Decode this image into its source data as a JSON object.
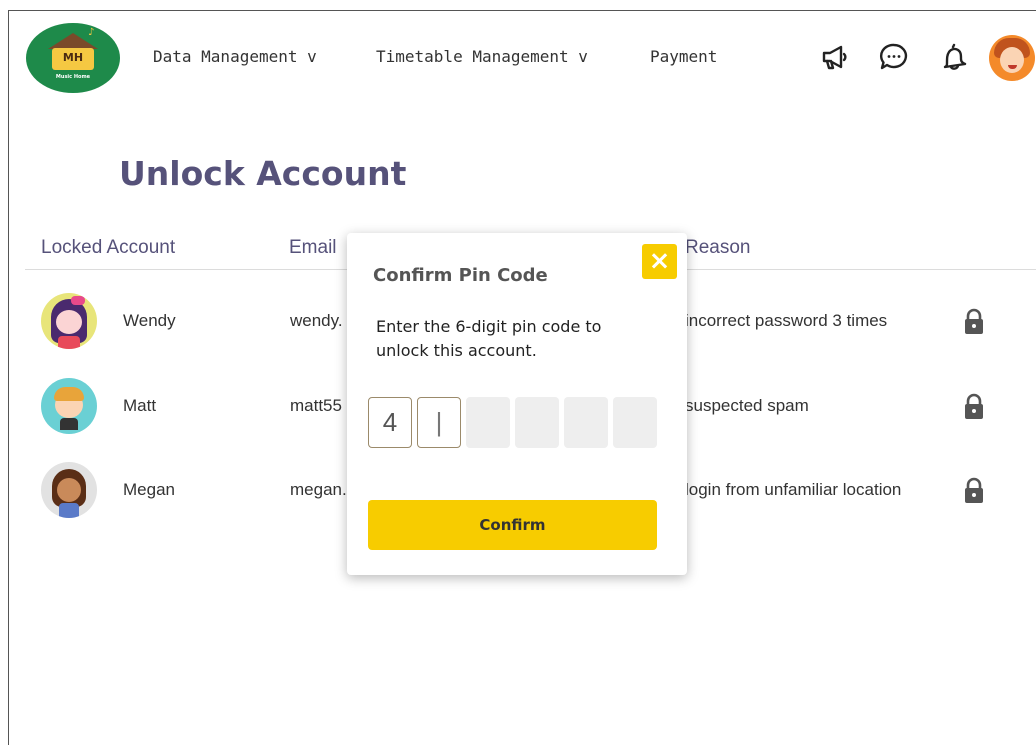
{
  "header": {
    "logo_text": "MH",
    "logo_subtext": "Music Home",
    "nav": [
      {
        "label": "Data Management v"
      },
      {
        "label": "Timetable Management v"
      },
      {
        "label": "Payment"
      }
    ],
    "icons": [
      "megaphone-icon",
      "chat-icon",
      "bell-icon",
      "user-avatar"
    ]
  },
  "page": {
    "title": "Unlock Account"
  },
  "table": {
    "columns": [
      "Locked Account",
      "Email",
      "Reason"
    ],
    "rows": [
      {
        "name": "Wendy",
        "email": "wendy.",
        "reason": "incorrect password 3 times",
        "icon": "lock-icon"
      },
      {
        "name": "Matt",
        "email": "matt55",
        "reason": "suspected spam",
        "icon": "lock-icon"
      },
      {
        "name": "Megan",
        "email": "megan.",
        "reason": "login from unfamiliar location",
        "icon": "lock-icon"
      }
    ]
  },
  "modal": {
    "title": "Confirm Pin Code",
    "close_label": "×",
    "message": "Enter the 6-digit pin code to unlock this account.",
    "pin": [
      "4",
      "|",
      "",
      "",
      "",
      ""
    ],
    "confirm_label": "Confirm"
  },
  "colors": {
    "accent": "#f7cc00",
    "title": "#56527a",
    "logo_bg": "#1e8a4a"
  }
}
